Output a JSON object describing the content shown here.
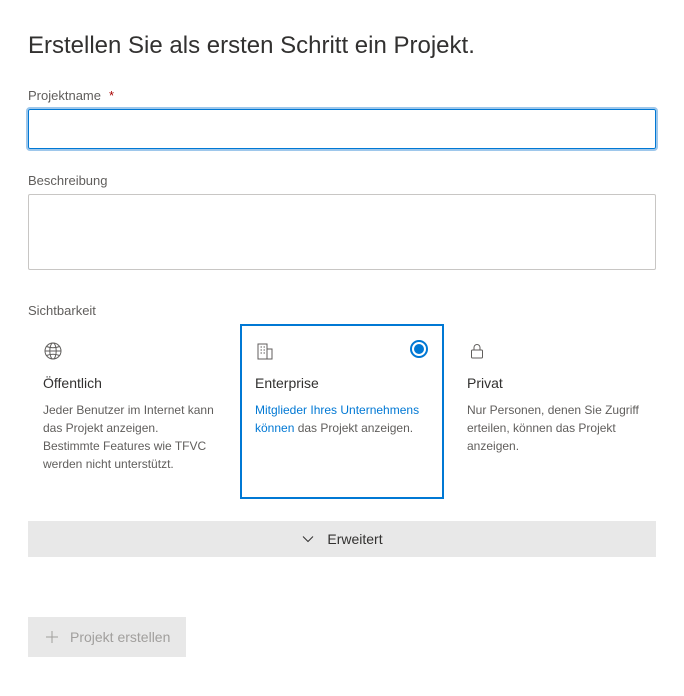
{
  "header": {
    "title": "Erstellen Sie als ersten Schritt ein Projekt."
  },
  "projectName": {
    "label": "Projektname",
    "required": "*",
    "value": ""
  },
  "description": {
    "label": "Beschreibung",
    "value": ""
  },
  "visibility": {
    "label": "Sichtbarkeit",
    "options": {
      "public": {
        "title": "Öffentlich",
        "desc": "Jeder Benutzer im Internet kann das Projekt anzeigen. Bestimmte Features wie TFVC werden nicht unterstützt."
      },
      "enterprise": {
        "title": "Enterprise",
        "link": "Mitglieder Ihres Unternehmens können",
        "desc_rest": " das Projekt anzeigen."
      },
      "private": {
        "title": "Privat",
        "desc": "Nur Personen, denen Sie Zugriff erteilen, können das Projekt anzeigen."
      }
    }
  },
  "advanced": {
    "label": "Erweitert"
  },
  "createButton": {
    "label": "Projekt erstellen"
  }
}
